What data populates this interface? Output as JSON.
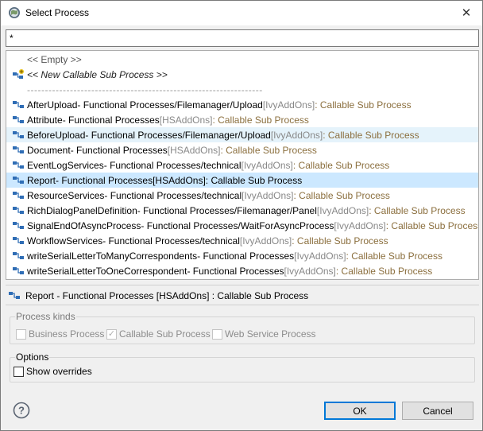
{
  "window": {
    "title": "Select Process"
  },
  "filter": {
    "value": "*"
  },
  "list": {
    "special_empty": "<< Empty >>",
    "special_new": "<< New Callable Sub Process >>",
    "separator": "------------------------------------------------------------------",
    "items": [
      {
        "name": "AfterUpload",
        "path": " - Functional Processes/Filemanager/Upload ",
        "project": "[IvyAddOns]",
        "kind": " : Callable Sub Process"
      },
      {
        "name": "Attribute",
        "path": " - Functional Processes ",
        "project": "[HSAddOns]",
        "kind": " : Callable Sub Process"
      },
      {
        "name": "BeforeUpload",
        "path": " - Functional Processes/Filemanager/Upload ",
        "project": "[IvyAddOns]",
        "kind": " : Callable Sub Process"
      },
      {
        "name": "Document",
        "path": " - Functional Processes ",
        "project": "[HSAddOns]",
        "kind": " : Callable Sub Process"
      },
      {
        "name": "EventLogServices",
        "path": " - Functional Processes/technical ",
        "project": "[IvyAddOns]",
        "kind": " : Callable Sub Process"
      },
      {
        "name": "Report",
        "path": " - Functional Processes ",
        "project": "[HSAddOns]",
        "kind": " : Callable Sub Process"
      },
      {
        "name": "ResourceServices",
        "path": " - Functional Processes/technical ",
        "project": "[IvyAddOns]",
        "kind": " : Callable Sub Process"
      },
      {
        "name": "RichDialogPanelDefinition",
        "path": " - Functional Processes/Filemanager/Panel ",
        "project": "[IvyAddOns]",
        "kind": " : Callable Sub Process"
      },
      {
        "name": "SignalEndOfAsyncProcess",
        "path": " - Functional Processes/WaitForAsyncProcess ",
        "project": "[IvyAddOns]",
        "kind": " : Callable Sub Process"
      },
      {
        "name": "WorkflowServices",
        "path": " - Functional Processes/technical ",
        "project": "[IvyAddOns]",
        "kind": " : Callable Sub Process"
      },
      {
        "name": "writeSerialLetterToManyCorrespondents",
        "path": " - Functional Processes ",
        "project": "[IvyAddOns]",
        "kind": " : Callable Sub Process"
      },
      {
        "name": "writeSerialLetterToOneCorrespondent",
        "path": " - Functional Processes ",
        "project": "[IvyAddOns]",
        "kind": " : Callable Sub Process"
      }
    ],
    "hover_index": 2,
    "selected_index": 5
  },
  "status": {
    "text": "Report - Functional Processes [HSAddOns] : Callable Sub Process"
  },
  "process_kinds": {
    "legend": "Process kinds",
    "business": {
      "label": "Business Process",
      "checked": false
    },
    "callable": {
      "label": "Callable Sub Process",
      "checked": true
    },
    "webservice": {
      "label": "Web Service Process",
      "checked": false
    }
  },
  "options": {
    "legend": "Options",
    "show_overrides": {
      "label": "Show overrides",
      "checked": false
    }
  },
  "buttons": {
    "ok": "OK",
    "cancel": "Cancel"
  },
  "icons": {
    "app": "globe-icon",
    "close": "close-icon",
    "process": "callable-process-icon",
    "new_process": "new-callable-process-icon",
    "help": "help-icon"
  },
  "colors": {
    "selection": "#cce8ff",
    "hover": "#e5f3fb",
    "project_tag": "#888888",
    "kind_text": "#8b6f3e",
    "default_button_border": "#0078d7"
  }
}
